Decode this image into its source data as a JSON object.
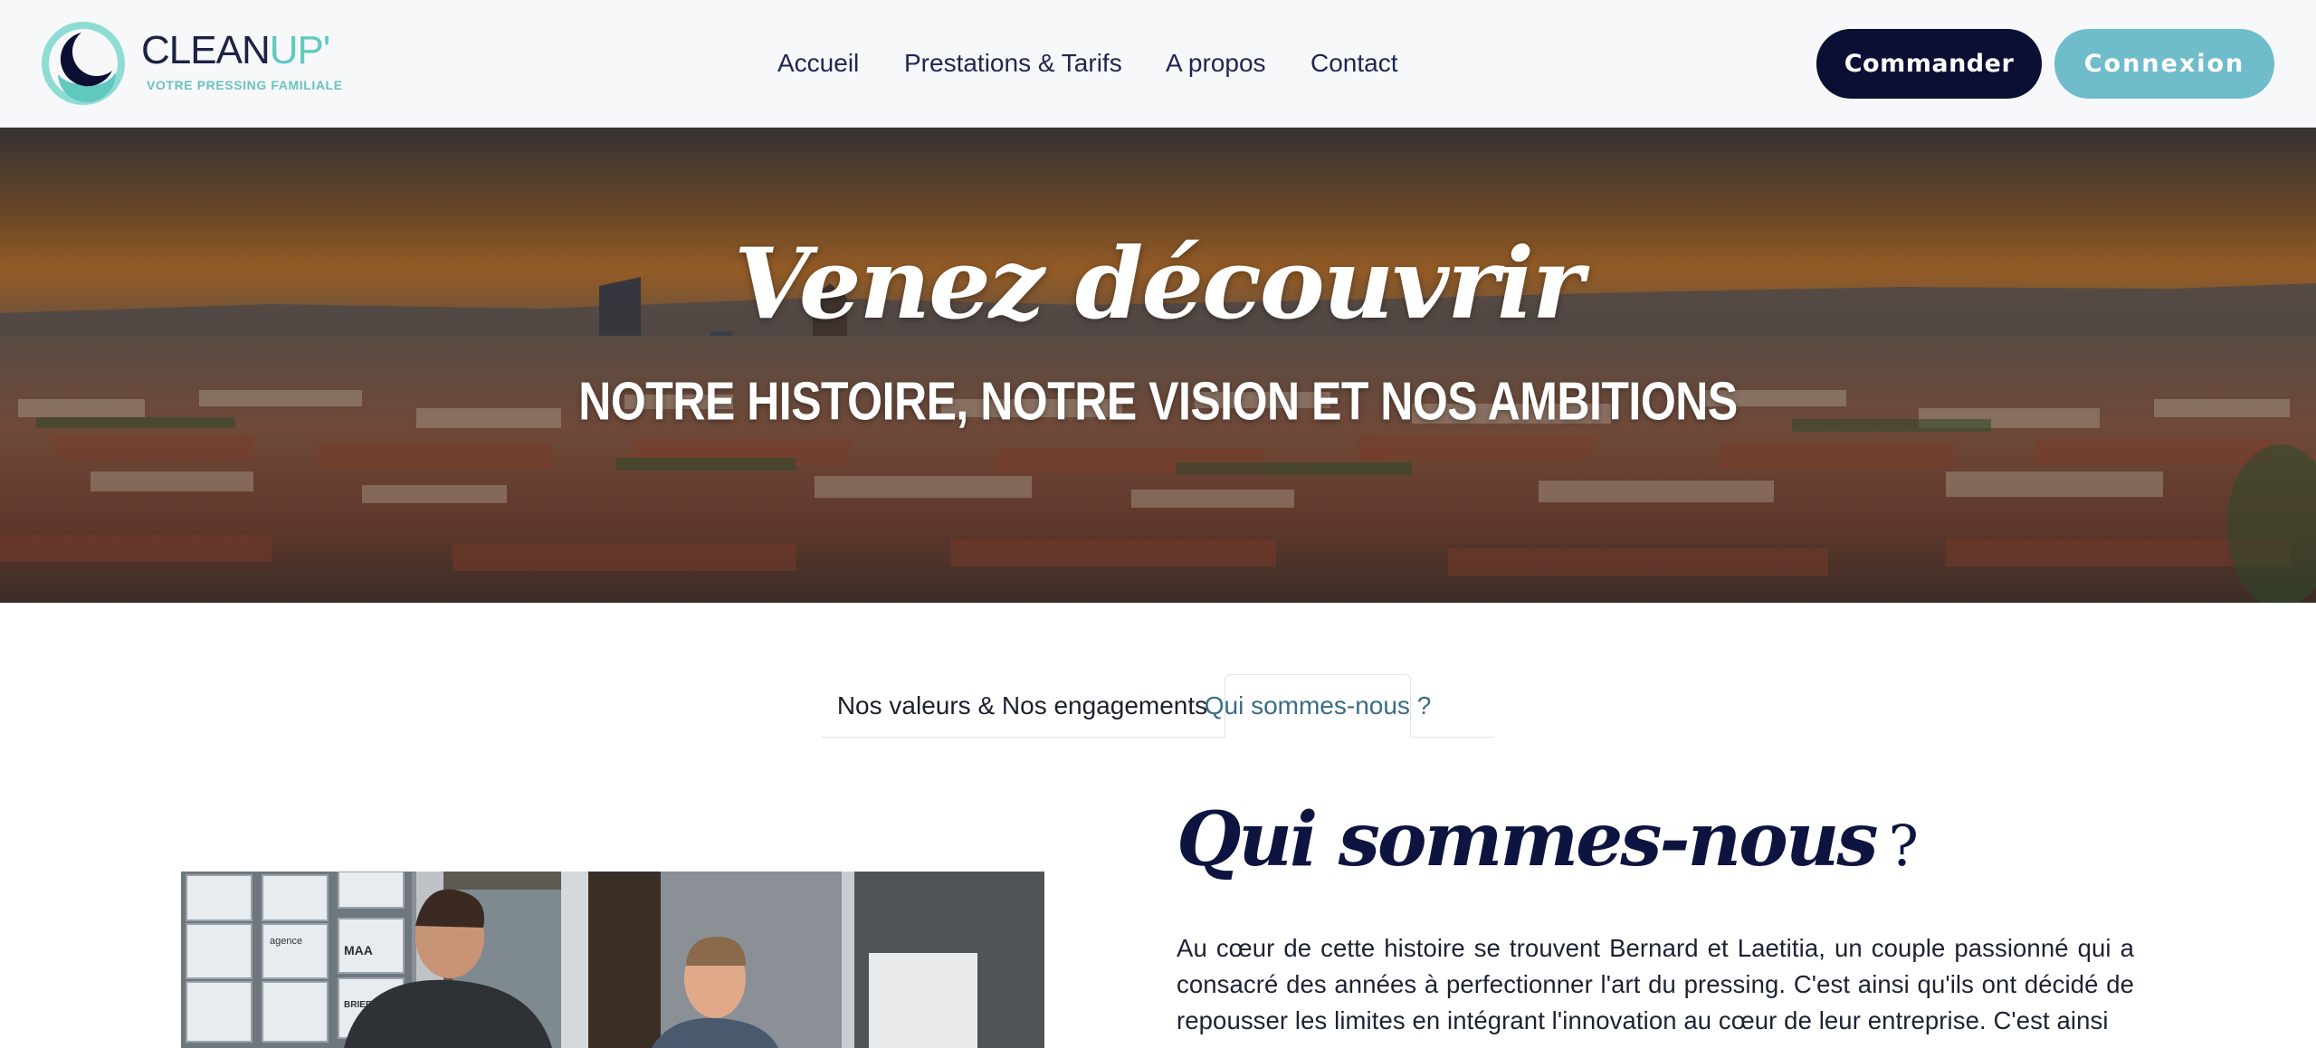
{
  "header": {
    "logo": {
      "name": "CLEAN",
      "name_accent": "UP'",
      "tagline": "VOTRE PRESSING FAMILIALE"
    },
    "nav": [
      {
        "label": "Accueil"
      },
      {
        "label": "Prestations & Tarifs"
      },
      {
        "label": "A propos"
      },
      {
        "label": "Contact"
      }
    ],
    "order_button": "Commander",
    "login_button": "Connexion"
  },
  "hero": {
    "title": "Venez découvrir",
    "subtitle": "NOTRE HISTOIRE, NOTRE VISION ET NOS AMBITIONS"
  },
  "tabs": [
    {
      "label": "Nos valeurs & Nos engagements",
      "active": false
    },
    {
      "label": "Qui sommes-nous ?",
      "active": true
    }
  ],
  "about": {
    "title": "Qui sommes-nous",
    "title_mark": "?",
    "paragraph": "Au cœur de cette histoire se trouvent Bernard et Laetitia, un couple passionné qui a consacré des années à perfectionner l'art du pressing. C'est ainsi qu'ils ont décidé de repousser les limites en intégrant l'innovation au cœur de leur entreprise. C'est ainsi",
    "photo_signs": [
      "agence",
      "MAA",
      "BRIEFING"
    ]
  },
  "colors": {
    "primary_dark": "#0b0f33",
    "accent_teal": "#6fbccb",
    "logo_mint": "#5fc9c0",
    "active_tab_text": "#3a6d86"
  }
}
